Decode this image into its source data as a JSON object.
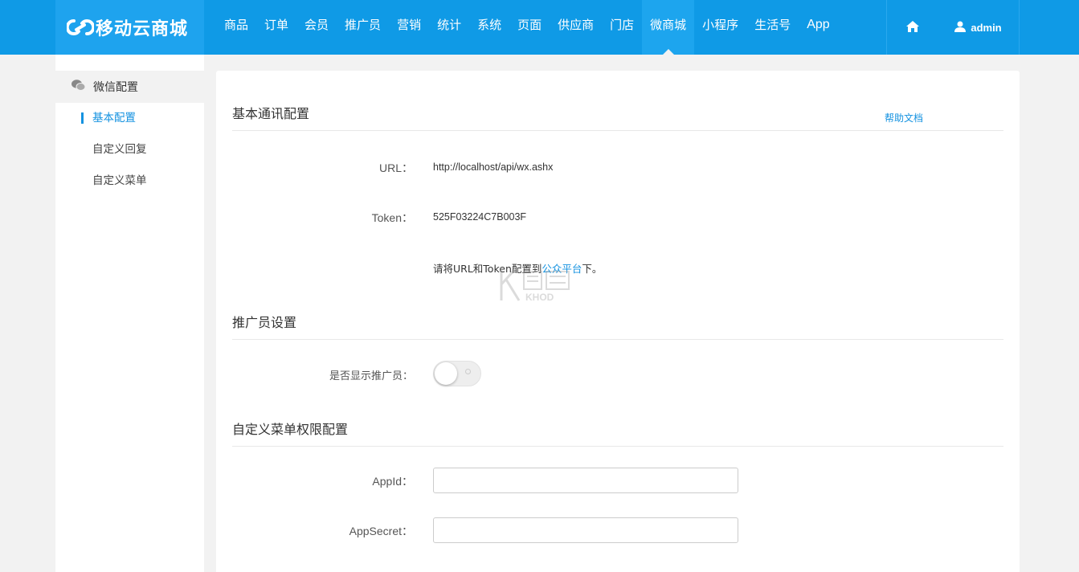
{
  "header": {
    "logo_text": "移动云商城",
    "nav": [
      {
        "label": "商品",
        "active": false
      },
      {
        "label": "订单",
        "active": false
      },
      {
        "label": "会员",
        "active": false
      },
      {
        "label": "推广员",
        "active": false
      },
      {
        "label": "营销",
        "active": false
      },
      {
        "label": "统计",
        "active": false
      },
      {
        "label": "系统",
        "active": false
      },
      {
        "label": "页面",
        "active": false
      },
      {
        "label": "供应商",
        "active": false
      },
      {
        "label": "门店",
        "active": false
      },
      {
        "label": "微商城",
        "active": true
      },
      {
        "label": "小程序",
        "active": false
      },
      {
        "label": "生活号",
        "active": false
      },
      {
        "label": "App",
        "active": false
      }
    ],
    "home_icon": "home-icon",
    "user_icon": "user-icon",
    "username": "admin"
  },
  "sidebar": {
    "group_label": "微信配置",
    "group_icon": "wechat-icon",
    "items": [
      {
        "label": "基本配置",
        "active": true
      },
      {
        "label": "自定义回复",
        "active": false
      },
      {
        "label": "自定义菜单",
        "active": false
      }
    ]
  },
  "main": {
    "basic": {
      "title": "基本通讯配置",
      "help_link": "帮助文档",
      "url_label": "URL：",
      "url_value": "http://localhost/api/wx.ashx",
      "token_label": "Token：",
      "token_value": "525F03224C7B003F",
      "note_prefix": "请将URL和Token配置到",
      "note_link": "公众平台",
      "note_suffix": "下。"
    },
    "promoter": {
      "title": "推广员设置",
      "show_label": "是否显示推广员：",
      "show_enabled": false
    },
    "menu_auth": {
      "title": "自定义菜单权限配置",
      "appid_label": "AppId：",
      "appid_value": "",
      "appsecret_label": "AppSecret：",
      "appsecret_value": ""
    }
  },
  "watermark_text": "KHOD",
  "colors": {
    "header_bg": "#0f9ae6",
    "accent": "#1492e0",
    "page_bg": "#f2f2f2"
  }
}
